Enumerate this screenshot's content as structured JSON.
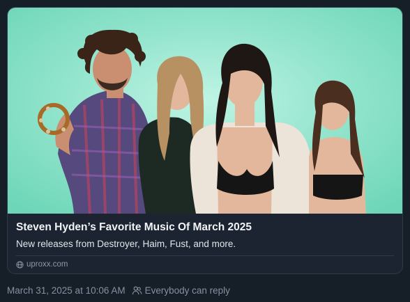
{
  "link_card": {
    "title": "Steven Hyden’s Favorite Music Of March 2025",
    "description": "New releases from Destroyer, Haim, Fust, and more.",
    "domain": "uproxx.com",
    "source_icon": "globe-icon",
    "thumbnail_background": "#8fe3cb"
  },
  "post_meta": {
    "timestamp": "March 31, 2025 at 10:06 AM",
    "reply_setting_icon": "people-icon",
    "reply_setting": "Everybody can reply"
  },
  "colors": {
    "page_background": "#161e28",
    "card_background": "#1b2430",
    "title_text": "#f1f3f6",
    "muted_text": "#8591a1"
  }
}
